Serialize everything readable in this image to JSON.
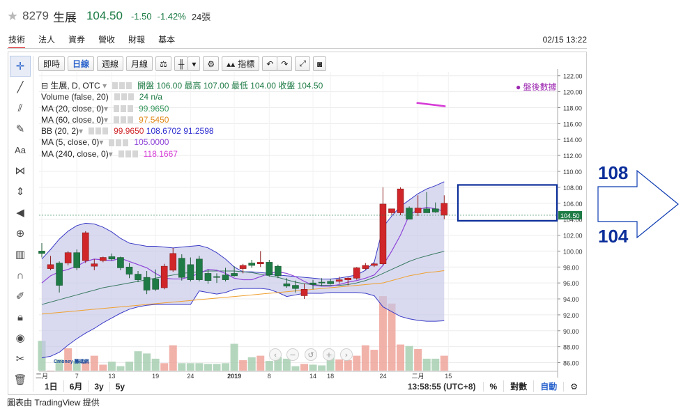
{
  "header": {
    "symbol": "8279",
    "name": "生展",
    "price": "104.50",
    "change": "-1.50",
    "change_pct": "-1.42%",
    "volume": "24張"
  },
  "tabs": [
    "技術",
    "法人",
    "資券",
    "營收",
    "財報",
    "基本"
  ],
  "datetime": "02/15 13:22",
  "toolbar": {
    "intraday": "即時",
    "daily": "日線",
    "weekly": "週線",
    "monthly": "月線",
    "indicators": "指標"
  },
  "legend": {
    "main": "生展, D, OTC",
    "ohlc": "開盤 106.00 最高 107.00 最低 104.00 收盤 104.50",
    "volume_label": "Volume (false, 20)",
    "volume_value": "24 n/a",
    "ma20_label": "MA (20, close, 0)",
    "ma20_value": "99.9650",
    "ma60_label": "MA (60, close, 0)",
    "ma60_value": "97.5450",
    "bb_label": "BB (20, 2)",
    "bb_mid": "99.9650",
    "bb_up": "108.6702",
    "bb_low": "91.2598",
    "ma5_label": "MA (5, close, 0)",
    "ma5_value": "105.0000",
    "ma240_label": "MA (240, close, 0)",
    "ma240_value": "118.1667"
  },
  "after_hours": "盤後數據",
  "price_tag": "104.50",
  "annotations": {
    "upper": "108",
    "lower": "104"
  },
  "range_buttons": [
    "1日",
    "6月",
    "3y",
    "5y"
  ],
  "clock": "13:58:55 (UTC+8)",
  "pct_btn": "%",
  "log_btn": "對數",
  "auto_btn": "自動",
  "watermark": "Cmoney 籌碼網",
  "credit": "圖表由 TradingView 提供",
  "colors": {
    "up": "#d0262a",
    "down": "#1e7b45",
    "bb_fill": "#c5c6e8",
    "bb_line": "#3a3ac6",
    "ma20": "#3b7a62",
    "ma60": "#f0a030",
    "ma5": "#8e44d8",
    "ma240": "#d63ad6",
    "annotation": "#0b2e9a"
  },
  "chart_data": {
    "type": "candlestick",
    "x_ticks": [
      "二月",
      "7",
      "13",
      "19",
      "24",
      "2019",
      "8",
      "14",
      "18",
      "24",
      "二月",
      "15"
    ],
    "y_ticks": [
      86,
      88,
      90,
      92,
      94,
      96,
      98,
      100,
      102,
      104,
      106,
      108,
      110,
      112,
      114,
      116,
      118,
      120,
      122
    ],
    "ylim": [
      85,
      122.5
    ],
    "candles": [
      {
        "o": 100.0,
        "h": 101.0,
        "l": 99.2,
        "c": 99.7
      },
      {
        "o": 97.8,
        "h": 99.4,
        "l": 97.6,
        "c": 98.3
      },
      {
        "o": 98.5,
        "h": 98.7,
        "l": 94.8,
        "c": 95.7
      },
      {
        "o": 98.5,
        "h": 100.0,
        "l": 98.2,
        "c": 99.8
      },
      {
        "o": 99.8,
        "h": 100.2,
        "l": 97.6,
        "c": 97.9
      },
      {
        "o": 98.8,
        "h": 102.5,
        "l": 98.5,
        "c": 102.3
      },
      {
        "o": 98.1,
        "h": 99.0,
        "l": 97.6,
        "c": 98.4
      },
      {
        "o": 98.8,
        "h": 99.3,
        "l": 98.6,
        "c": 99.2
      },
      {
        "o": 99.3,
        "h": 99.7,
        "l": 98.8,
        "c": 99.0
      },
      {
        "o": 99.2,
        "h": 99.3,
        "l": 97.6,
        "c": 97.9
      },
      {
        "o": 98.0,
        "h": 98.5,
        "l": 96.6,
        "c": 97.1
      },
      {
        "o": 97.1,
        "h": 97.5,
        "l": 96.1,
        "c": 96.4
      },
      {
        "o": 96.7,
        "h": 97.5,
        "l": 94.6,
        "c": 95.1
      },
      {
        "o": 96.5,
        "h": 97.7,
        "l": 95.0,
        "c": 95.2
      },
      {
        "o": 95.4,
        "h": 98.4,
        "l": 95.2,
        "c": 98.1
      },
      {
        "o": 97.6,
        "h": 100.4,
        "l": 97.4,
        "c": 99.7
      },
      {
        "o": 99.1,
        "h": 99.6,
        "l": 96.3,
        "c": 96.7
      },
      {
        "o": 98.3,
        "h": 99.2,
        "l": 96.2,
        "c": 96.4
      },
      {
        "o": 99.0,
        "h": 99.4,
        "l": 96.2,
        "c": 96.4
      },
      {
        "o": 97.2,
        "h": 97.7,
        "l": 95.9,
        "c": 96.3
      },
      {
        "o": 96.8,
        "h": 97.2,
        "l": 96.0,
        "c": 96.7
      },
      {
        "o": 97.0,
        "h": 97.9,
        "l": 96.2,
        "c": 96.4
      },
      {
        "o": 97.2,
        "h": 98.1,
        "l": 96.8,
        "c": 96.9
      },
      {
        "o": 97.8,
        "h": 98.4,
        "l": 97.2,
        "c": 98.2
      },
      {
        "o": 98.5,
        "h": 98.9,
        "l": 97.9,
        "c": 98.2
      },
      {
        "o": 98.4,
        "h": 100.0,
        "l": 98.0,
        "c": 98.6
      },
      {
        "o": 98.6,
        "h": 98.9,
        "l": 96.8,
        "c": 97.0
      },
      {
        "o": 98.1,
        "h": 98.3,
        "l": 96.6,
        "c": 96.9
      },
      {
        "o": 95.9,
        "h": 96.6,
        "l": 95.4,
        "c": 95.6
      },
      {
        "o": 95.7,
        "h": 96.3,
        "l": 94.8,
        "c": 95.3
      },
      {
        "o": 94.4,
        "h": 95.9,
        "l": 94.0,
        "c": 95.2
      },
      {
        "o": 96.0,
        "h": 96.4,
        "l": 95.2,
        "c": 95.8
      },
      {
        "o": 96.1,
        "h": 96.6,
        "l": 95.6,
        "c": 96.0
      },
      {
        "o": 96.2,
        "h": 96.5,
        "l": 95.8,
        "c": 95.9
      },
      {
        "o": 96.2,
        "h": 96.8,
        "l": 95.9,
        "c": 96.4
      },
      {
        "o": 96.4,
        "h": 96.7,
        "l": 95.7,
        "c": 96.6
      },
      {
        "o": 96.6,
        "h": 98.0,
        "l": 96.4,
        "c": 97.9
      },
      {
        "o": 97.8,
        "h": 98.5,
        "l": 97.6,
        "c": 98.2
      },
      {
        "o": 98.2,
        "h": 98.5,
        "l": 98.0,
        "c": 98.4
      },
      {
        "o": 98.4,
        "h": 108.0,
        "l": 98.2,
        "c": 105.9
      },
      {
        "o": 104.8,
        "h": 105.2,
        "l": 104.5,
        "c": 105.3
      },
      {
        "o": 104.8,
        "h": 108.0,
        "l": 104.5,
        "c": 107.8
      },
      {
        "o": 105.4,
        "h": 105.6,
        "l": 104.0,
        "c": 104.0
      },
      {
        "o": 104.8,
        "h": 107.0,
        "l": 104.4,
        "c": 105.4
      },
      {
        "o": 105.3,
        "h": 107.4,
        "l": 105.0,
        "c": 104.8
      },
      {
        "o": 105.3,
        "h": 106.1,
        "l": 104.8,
        "c": 104.9
      },
      {
        "o": 104.5,
        "h": 107.0,
        "l": 104.0,
        "c": 106.0
      }
    ],
    "volume": [
      4,
      0,
      1.5,
      3,
      1.3,
      1.2,
      2,
      0.8,
      1.2,
      0.6,
      1.2,
      2.6,
      2.3,
      1.6,
      1.0,
      3.4,
      1.0,
      1.0,
      1.0,
      0.9,
      0.9,
      1.0,
      3.6,
      1.4,
      1.8,
      2.0,
      1.3,
      1.8,
      1.6,
      0.6,
      0.9,
      0.8,
      0.7,
      2.2,
      1.5,
      1.4,
      2.0,
      3.4,
      2.8,
      10,
      9,
      3.5,
      3.3,
      2.9,
      1.6,
      1.6,
      2.0
    ],
    "bb_upper": [
      99.0,
      100.2,
      101.5,
      102.5,
      103.2,
      103.5,
      103.4,
      103.0,
      102.4,
      101.6,
      101.0,
      100.8,
      100.6,
      100.6,
      100.5,
      100.4,
      100.5,
      100.6,
      100.7,
      100.4,
      99.8,
      99.0,
      98.0,
      97.4,
      97.4,
      97.3,
      97.2,
      97.0,
      96.9,
      96.8,
      96.7,
      96.6,
      96.5,
      96.5,
      96.6,
      96.8,
      97.0,
      97.6,
      98.6,
      103.0,
      104.4,
      105.6,
      106.4,
      107.2,
      107.8,
      108.2,
      108.7
    ],
    "bb_lower": [
      86.6,
      86.8,
      87.3,
      88.2,
      89.0,
      89.7,
      90.3,
      91.0,
      91.6,
      92.2,
      92.7,
      93.0,
      93.2,
      93.3,
      93.3,
      93.3,
      93.3,
      93.3,
      95.0,
      94.8,
      94.6,
      94.8,
      95.2,
      95.3,
      95.3,
      95.3,
      95.2,
      94.8,
      94.3,
      94.5,
      94.7,
      94.7,
      94.7,
      94.8,
      94.8,
      94.8,
      94.8,
      94.7,
      94.4,
      93.0,
      92.4,
      91.8,
      91.5,
      91.3,
      91.2,
      91.2,
      91.26
    ],
    "ma20": [
      93.3,
      93.6,
      93.9,
      94.2,
      94.5,
      94.8,
      95.1,
      95.4,
      95.6,
      95.8,
      96.0,
      96.2,
      96.4,
      96.6,
      96.8,
      97.0,
      97.2,
      97.3,
      97.4,
      97.5,
      97.5,
      97.5,
      97.5,
      97.4,
      97.3,
      97.1,
      96.9,
      96.7,
      96.4,
      96.1,
      95.9,
      95.8,
      95.7,
      95.7,
      95.7,
      95.8,
      96.0,
      96.3,
      96.7,
      97.2,
      97.7,
      98.2,
      98.7,
      99.1,
      99.4,
      99.7,
      99.965
    ],
    "ma60": [
      92.1,
      92.2,
      92.3,
      92.4,
      92.5,
      92.6,
      92.7,
      92.8,
      92.9,
      93.0,
      93.1,
      93.2,
      93.3,
      93.4,
      93.5,
      93.6,
      93.7,
      93.8,
      93.9,
      94.0,
      94.1,
      94.2,
      94.3,
      94.4,
      94.5,
      94.6,
      94.7,
      94.8,
      94.9,
      95.0,
      95.1,
      95.2,
      95.3,
      95.4,
      95.5,
      95.6,
      95.7,
      95.8,
      95.9,
      96.0,
      96.3,
      96.6,
      96.9,
      97.1,
      97.3,
      97.4,
      97.545
    ],
    "ma5": [
      96.0,
      96.9,
      97.4,
      97.7,
      98.1,
      98.7,
      99.0,
      98.9,
      98.8,
      99.1,
      98.7,
      98.3,
      97.9,
      97.2,
      96.6,
      96.5,
      96.5,
      96.8,
      97.2,
      97.7,
      97.6,
      97.2,
      96.6,
      96.4,
      96.4,
      96.8,
      97.2,
      97.4,
      97.2,
      96.8,
      96.2,
      95.7,
      95.6,
      95.6,
      95.8,
      96.1,
      96.3,
      96.6,
      97.0,
      98.2,
      100.0,
      102.0,
      104.5,
      105.2,
      105.5,
      105.3,
      105.0
    ],
    "ma240": [
      118.6,
      118.1667
    ]
  }
}
